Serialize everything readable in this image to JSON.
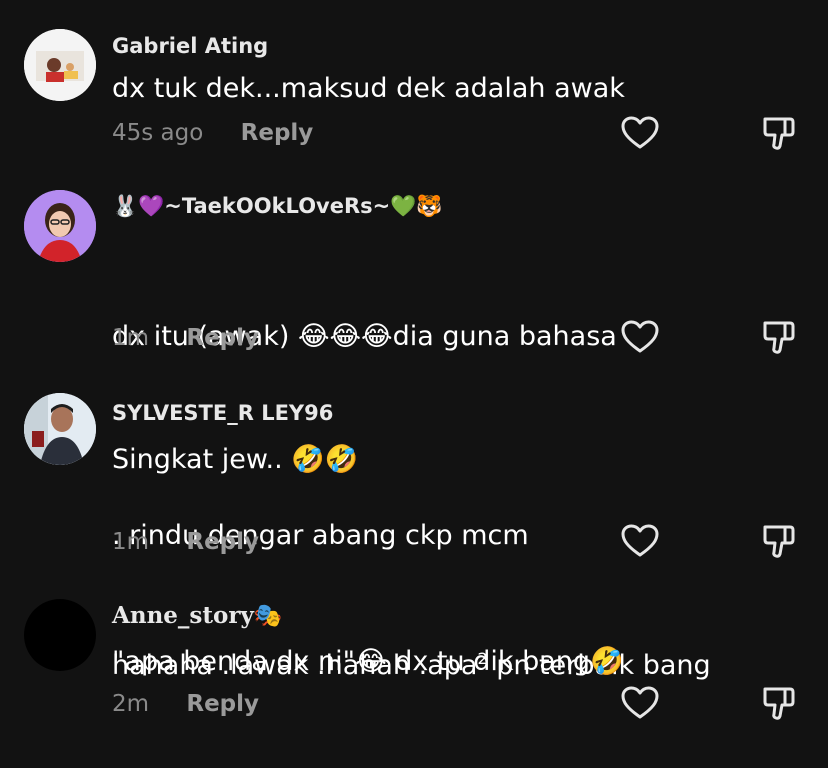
{
  "comments": [
    {
      "username": "Gabriel Ating",
      "text": "dx tuk dek...maksud dek adalah awak",
      "time": "45s ago",
      "reply_label": "Reply"
    },
    {
      "username": "🐰💜~TaekOOkLOveRs~💚🐯",
      "text_line1": "dx itu (awak) 😂😂😂dia guna bahasa",
      "text_line2": "Singkat jew.. 🤣🤣",
      "time": "1m",
      "reply_label": "Reply"
    },
    {
      "username": "SYLVESTE_R LEY96",
      "text_line1": ". rindu dengar abang ckp mcm",
      "text_line2_a": "hahaha .lawak .hahah .apa",
      "text_line2_sup": "2",
      "text_line2_b": " pn terbaik bang",
      "time": "1m",
      "reply_label": "Reply"
    },
    {
      "username": "Anne_story🎭",
      "text": "\"apa benda dx ni\"😂 dx tu dik bang🤣",
      "time": "2m",
      "reply_label": "Reply"
    }
  ],
  "icons": {
    "like": "heart-outline-icon",
    "dislike": "thumbs-down-outline-icon"
  },
  "colors": {
    "background": "#121212",
    "meta_text": "#8a8a8a",
    "avatar2_accent": "#b48cf0"
  }
}
